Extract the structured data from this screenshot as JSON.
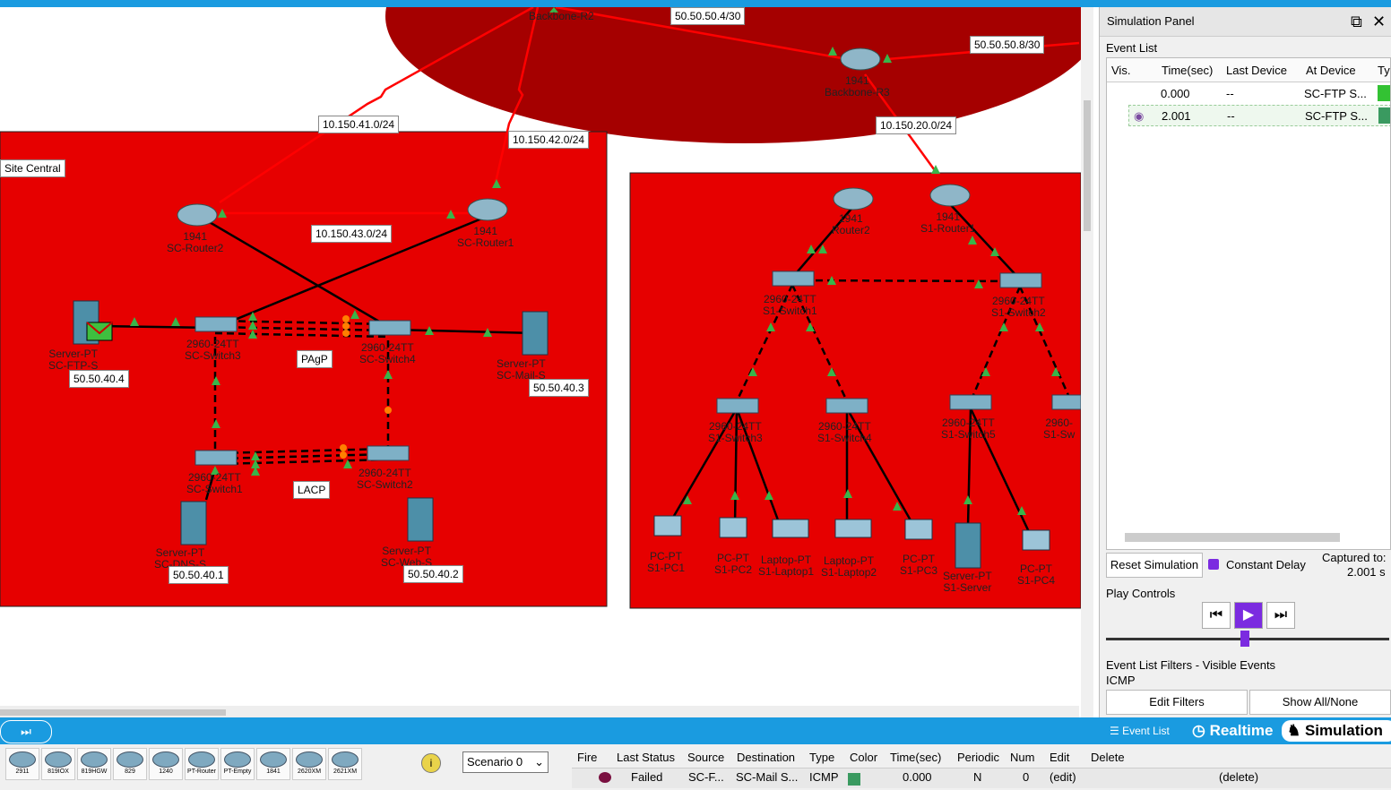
{
  "workspace": {
    "zones": {
      "backbone_r2": "Backbone-R2",
      "site_central": "Site Central"
    },
    "networks": [
      "50.50.50.4/30",
      "50.50.50.8/30",
      "10.150.41.0/24",
      "10.150.42.0/24",
      "10.150.20.0/24",
      "10.150.43.0/24"
    ],
    "protocols": {
      "pagp": "PAgP",
      "lacp": "LACP"
    },
    "ips": [
      "50.50.40.4",
      "50.50.40.3",
      "50.50.40.1",
      "50.50.40.2"
    ],
    "devices": {
      "backbone_r3": [
        "1941",
        "Backbone-R3"
      ],
      "sc_router2": [
        "1941",
        "SC-Router2"
      ],
      "sc_router1": [
        "1941",
        "SC-Router1"
      ],
      "sc_switch3": [
        "2960-24TT",
        "SC-Switch3"
      ],
      "sc_switch4": [
        "2960-24TT",
        "SC-Switch4"
      ],
      "sc_switch1": [
        "2960-24TT",
        "SC-Switch1"
      ],
      "sc_switch2": [
        "2960-24TT",
        "SC-Switch2"
      ],
      "sc_ftp": [
        "Server-PT",
        "SC-FTP-S"
      ],
      "sc_mail": [
        "Server-PT",
        "SC-Mail-S"
      ],
      "sc_dns": [
        "Server-PT",
        "SC-DNS-S"
      ],
      "sc_web": [
        "Server-PT",
        "SC-Web-S"
      ],
      "router2": [
        "1941",
        "Router2"
      ],
      "s1_router1": [
        "1941",
        "S1-Router1"
      ],
      "s1_switch1": [
        "2960-24TT",
        "S1-Switch1"
      ],
      "s1_switch2": [
        "2960-24TT",
        "S1-Switch2"
      ],
      "s1_switch3": [
        "2960-24TT",
        "S1-Switch3"
      ],
      "s1_switch4": [
        "2960-24TT",
        "S1-Switch4"
      ],
      "s1_switch5": [
        "2960-24TT",
        "S1-Switch5"
      ],
      "s1_switch6": [
        "2960-",
        "S1-Sw"
      ],
      "s1_pc1": [
        "PC-PT",
        "S1-PC1"
      ],
      "s1_pc2": [
        "PC-PT",
        "S1-PC2"
      ],
      "s1_laptop1": [
        "Laptop-PT",
        "S1-Laptop1"
      ],
      "s1_laptop2": [
        "Laptop-PT",
        "S1-Laptop2"
      ],
      "s1_pc3": [
        "PC-PT",
        "S1-PC3"
      ],
      "s1_server": [
        "Server-PT",
        "S1-Server"
      ],
      "s1_pc4": [
        "PC-PT",
        "S1-PC4"
      ]
    }
  },
  "panel": {
    "title": "Simulation Panel",
    "event_list_label": "Event List",
    "columns": [
      "Vis.",
      "Time(sec)",
      "Last Device",
      "At Device",
      "Ty"
    ],
    "events": [
      {
        "time": "0.000",
        "last": "--",
        "at": "SC-FTP S...",
        "color": "#33c233"
      },
      {
        "time": "2.001",
        "last": "--",
        "at": "SC-FTP S...",
        "color": "#3a9a60"
      }
    ],
    "reset_label": "Reset Simulation",
    "constant_delay_label": "Constant Delay",
    "captured_label": "Captured to:",
    "captured_value": "2.001 s",
    "play_controls_label": "Play Controls",
    "filters_label": "Event List Filters - Visible Events",
    "filters_value": "ICMP",
    "edit_filters_label": "Edit Filters",
    "show_all_label": "Show All/None",
    "play_progress": 0.49
  },
  "bottom": {
    "tabs": {
      "event_list": "Event List",
      "realtime": "Realtime",
      "simulation": "Simulation"
    },
    "device_types": [
      "2911",
      "819IOX",
      "819HGW",
      "829",
      "1240",
      "PT-Router",
      "PT-Empty",
      "1841",
      "2620XM",
      "2621XM"
    ],
    "scenario": "Scenario 0",
    "pdu_columns": [
      "Fire",
      "Last Status",
      "Source",
      "Destination",
      "Type",
      "Color",
      "Time(sec)",
      "Periodic",
      "Num",
      "Edit",
      "Delete"
    ],
    "pdu_row": {
      "status": "Failed",
      "source": "SC-F...",
      "destination": "SC-Mail S...",
      "type": "ICMP",
      "time": "0.000",
      "periodic": "N",
      "num": "0",
      "edit": "(edit)",
      "delete": "(delete)"
    }
  }
}
